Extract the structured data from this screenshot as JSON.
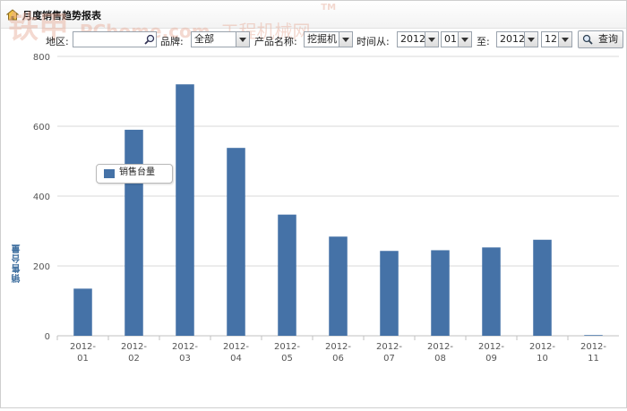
{
  "header": {
    "title": "月度销售趋势报表",
    "watermark_text": "铁甲",
    "watermark_sub": "工程机械网",
    "watermark_tm": "TM"
  },
  "filters": {
    "region_label": "地区:",
    "region_value": "",
    "brand_label": "品牌:",
    "brand_value": "全部",
    "product_label": "产品名称:",
    "product_value": "挖掘机",
    "time_from_label": "时间从:",
    "from_year": "2012",
    "from_month": "01",
    "to_label": "至:",
    "to_year": "2012",
    "to_month": "12",
    "search_label": "查询"
  },
  "colors": {
    "bar": "#4572a7",
    "grid": "#d8d8d8",
    "axis_text": "#555555"
  },
  "chart_data": {
    "type": "bar",
    "categories": [
      "2012-01",
      "2012-02",
      "2012-03",
      "2012-04",
      "2012-05",
      "2012-06",
      "2012-07",
      "2012-08",
      "2012-09",
      "2012-10",
      "2012-11"
    ],
    "series": [
      {
        "name": "销售台量",
        "values": [
          135,
          590,
          720,
          538,
          347,
          284,
          243,
          245,
          253,
          275,
          2
        ]
      }
    ],
    "ylabel": "销售台量",
    "ylim": [
      0,
      800
    ],
    "yticks": [
      "0",
      "200",
      "400",
      "600",
      "800"
    ],
    "grid": true,
    "legend_placement": "top-left"
  }
}
